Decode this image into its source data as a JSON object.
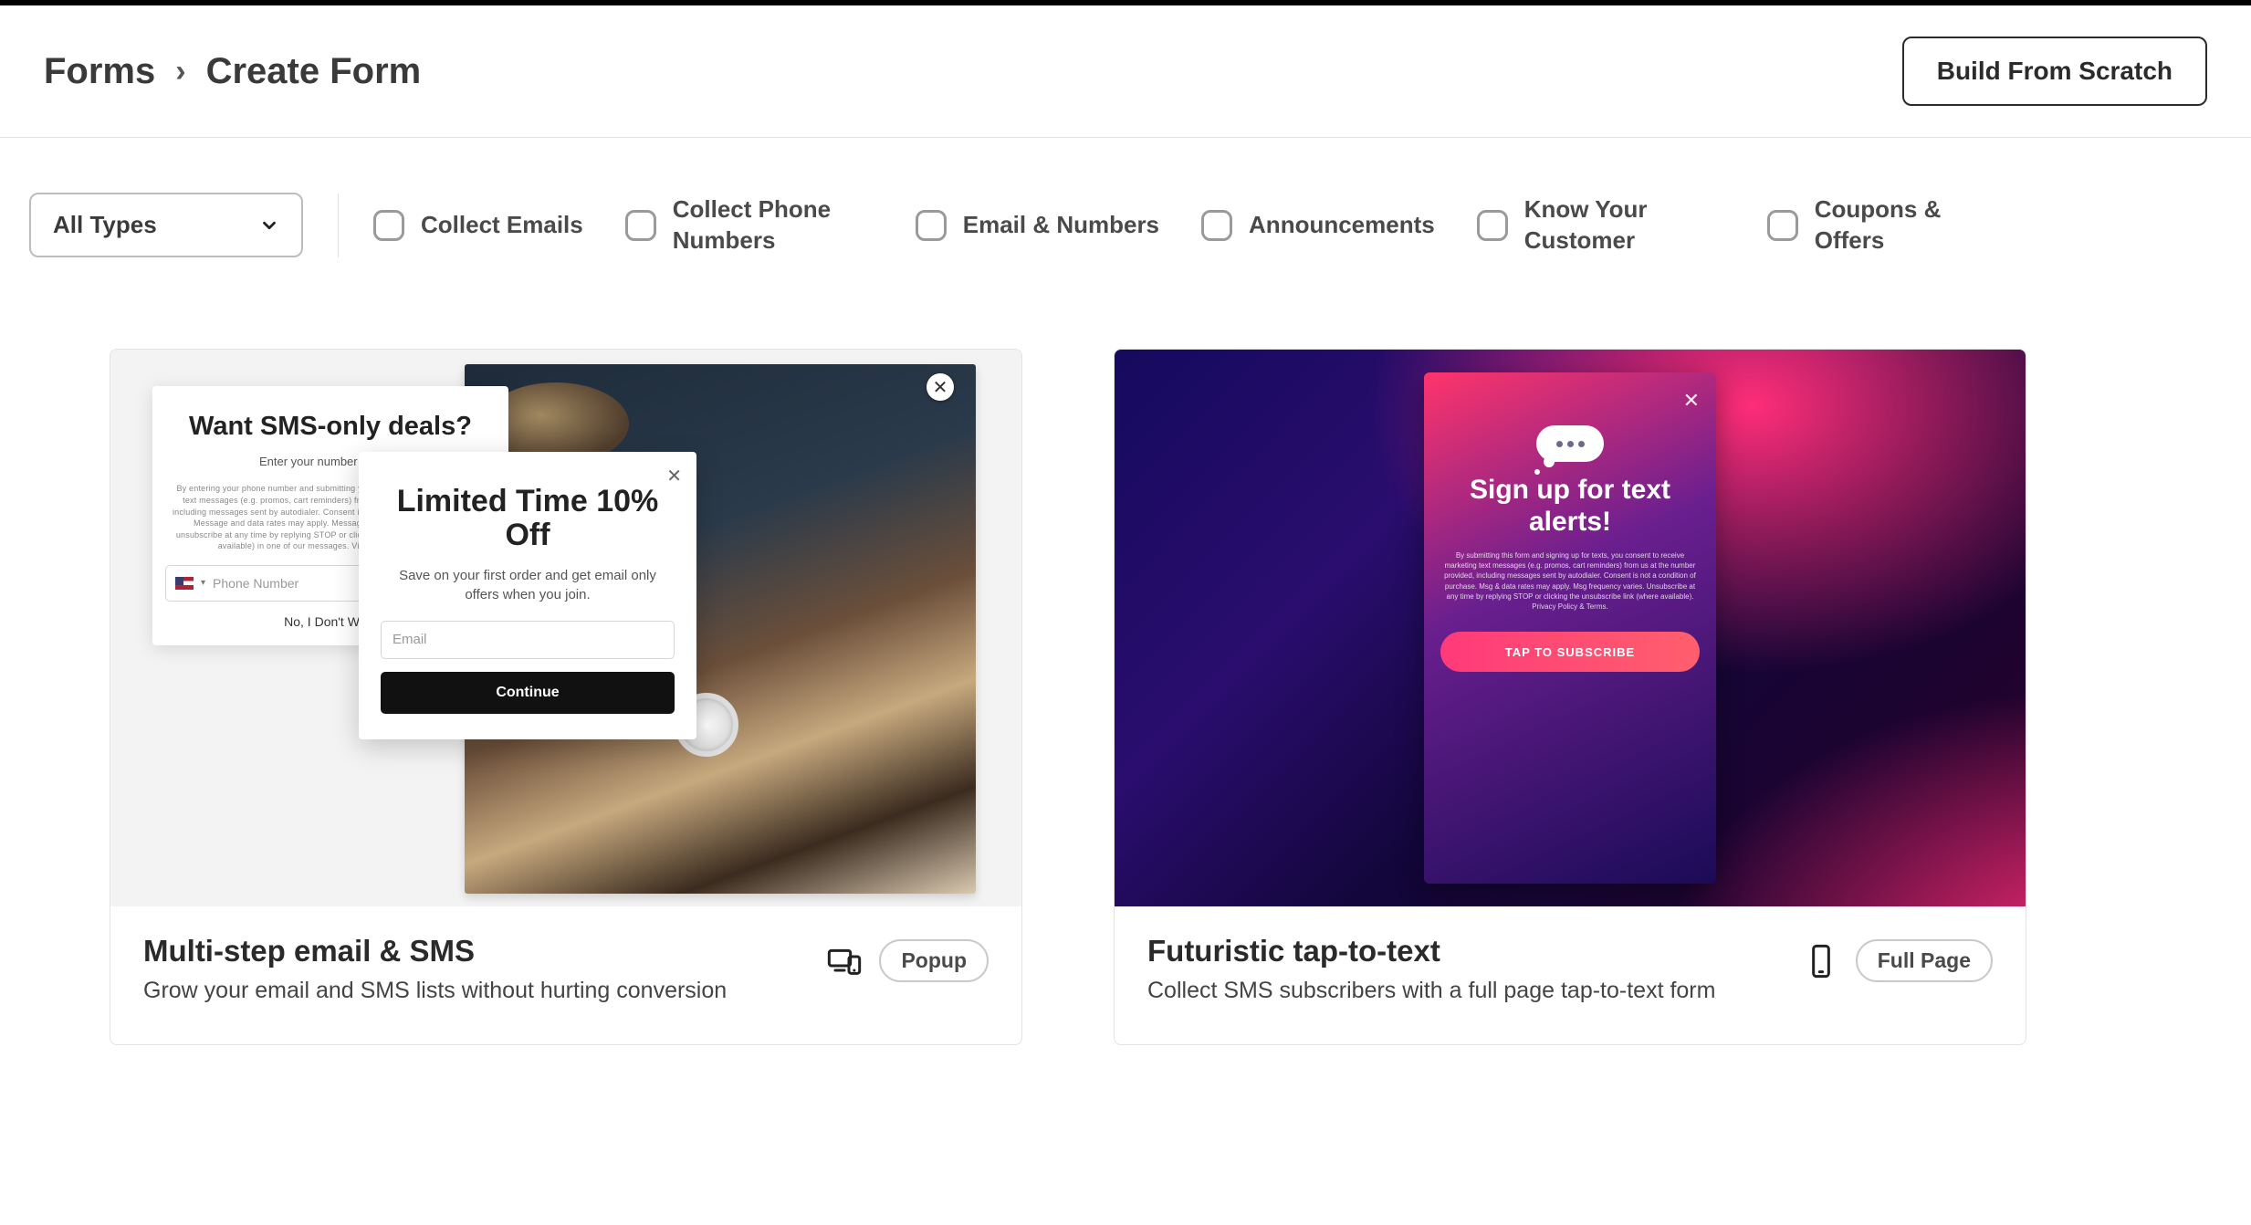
{
  "header": {
    "breadcrumb_root": "Forms",
    "breadcrumb_current": "Create Form",
    "build_button": "Build From Scratch"
  },
  "filters": {
    "dropdown_label": "All Types",
    "items": [
      {
        "label": "Collect Emails"
      },
      {
        "label": "Collect Phone Numbers"
      },
      {
        "label": "Email & Numbers"
      },
      {
        "label": "Announcements"
      },
      {
        "label": "Know Your Customer"
      },
      {
        "label": "Coupons & Offers"
      }
    ]
  },
  "cards": [
    {
      "title": "Multi-step email & SMS",
      "description": "Grow your email and SMS lists without hurting conversion",
      "badge": "Popup",
      "icon": "devices-icon"
    },
    {
      "title": "Futuristic tap-to-text",
      "description": "Collect SMS subscribers with a full page tap-to-text form",
      "badge": "Full Page",
      "icon": "mobile-icon"
    }
  ],
  "preview1": {
    "sms_title": "Want SMS-only deals?",
    "sms_sub": "Enter your number to get S",
    "sms_fine": "By entering your phone number and submitting you consent to receive marketing text messages (e.g. promos, cart reminders) from [Company Name] provided, including messages sent by autodialer. Consent is not a condition of any purchase. Message and data rates may apply. Message frequency varies. You can unsubscribe at any time by replying STOP or clicking the unsubscribe link (where available) in one of our messages. View our Privacy Policy.",
    "phone_placeholder": "Phone Number",
    "sms_decline": "No, I Don't Want",
    "main_title": "Limited Time 10% Off",
    "main_sub": "Save on your first order and get email only offers when you join.",
    "email_placeholder": "Email",
    "continue_label": "Continue"
  },
  "preview2": {
    "title": "Sign up for text alerts!",
    "fine": "By submitting this form and signing up for texts, you consent to receive marketing text messages (e.g. promos, cart reminders) from us at the number provided, including messages sent by autodialer. Consent is not a condition of purchase. Msg & data rates may apply. Msg frequency varies. Unsubscribe at any time by replying STOP or clicking the unsubscribe link (where available). Privacy Policy & Terms.",
    "cta": "TAP TO SUBSCRIBE"
  }
}
